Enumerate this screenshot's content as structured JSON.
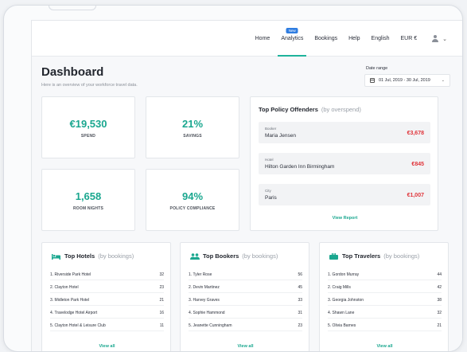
{
  "nav": {
    "items": [
      {
        "label": "Home",
        "active": false
      },
      {
        "label": "Analytics",
        "active": true,
        "badge": "New"
      },
      {
        "label": "Bookings",
        "active": false
      },
      {
        "label": "Help",
        "active": false
      },
      {
        "label": "English",
        "active": false
      },
      {
        "label": "EUR €",
        "active": false
      }
    ]
  },
  "header": {
    "title": "Dashboard",
    "subtitle": "Here is an overview of your workforce travel data.",
    "date_range_label": "Date range",
    "date_range_value": "01 Jul, 2019 - 30 Jul, 2019"
  },
  "stats": [
    {
      "value": "€19,530",
      "label": "SPEND"
    },
    {
      "value": "21%",
      "label": "SAVINGS"
    },
    {
      "value": "1,658",
      "label": "ROOM NIGHTS"
    },
    {
      "value": "94%",
      "label": "POLICY COMPLIANCE"
    }
  ],
  "offenders": {
    "title": "Top Policy Offenders",
    "subtitle": "(by overspend)",
    "rows": [
      {
        "type": "Booker",
        "name": "Maria Jensen",
        "amount": "€3,678"
      },
      {
        "type": "Hotel",
        "name": "Hilton Garden Inn Birmingham",
        "amount": "€845"
      },
      {
        "type": "City",
        "name": "Paris",
        "amount": "€1,007"
      }
    ],
    "link": "View Report"
  },
  "lists": [
    {
      "title": "Top Hotels",
      "subtitle": "(by bookings)",
      "icon": "bed-icon",
      "rows": [
        {
          "name": "1. Riverside Park Hotel",
          "count": "32"
        },
        {
          "name": "2. Clayton Hotel",
          "count": "23"
        },
        {
          "name": "3. Midleton Park Hotel",
          "count": "21"
        },
        {
          "name": "4. Travelodge Hotel Airport",
          "count": "16"
        },
        {
          "name": "5. Clayton Hotel & Leisure Club",
          "count": "11"
        }
      ],
      "link": "View all"
    },
    {
      "title": "Top Bookers",
      "subtitle": "(by bookings)",
      "icon": "people-icon",
      "rows": [
        {
          "name": "1. Tyler Rose",
          "count": "56"
        },
        {
          "name": "2. Devin Martinez",
          "count": "45"
        },
        {
          "name": "3. Harvey Graves",
          "count": "33"
        },
        {
          "name": "4. Sophie Hammond",
          "count": "31"
        },
        {
          "name": "5. Jeanette Cunningham",
          "count": "23"
        }
      ],
      "link": "View all"
    },
    {
      "title": "Top Travelers",
      "subtitle": "(by bookings)",
      "icon": "suitcase-icon",
      "rows": [
        {
          "name": "1. Gordon Murray",
          "count": "44"
        },
        {
          "name": "2. Craig Mills",
          "count": "42"
        },
        {
          "name": "3. Georgia Johnston",
          "count": "38"
        },
        {
          "name": "4. Shawn Lane",
          "count": "32"
        },
        {
          "name": "5. Olivia Barnes",
          "count": "21"
        }
      ],
      "link": "View all"
    }
  ],
  "colors": {
    "accent": "#1aa78f",
    "danger": "#e0343a",
    "badge": "#2f7de1"
  }
}
